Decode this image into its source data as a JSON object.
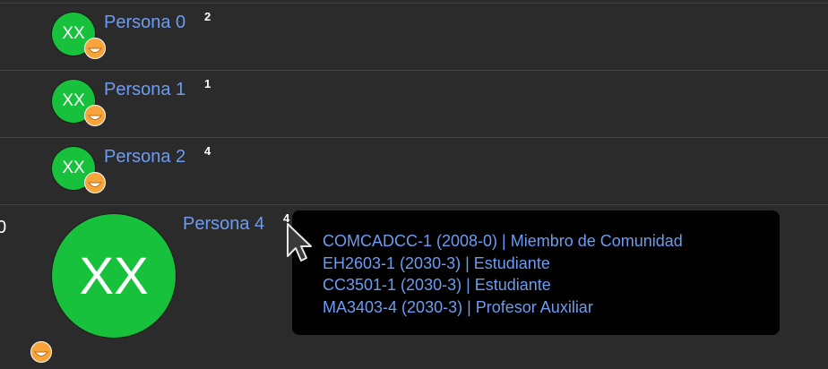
{
  "people": [
    {
      "name": "Persona 0",
      "count": "2",
      "initials": "XX"
    },
    {
      "name": "Persona 1",
      "count": "1",
      "initials": "XX"
    },
    {
      "name": "Persona 2",
      "count": "4",
      "initials": "XX"
    }
  ],
  "highlighted": {
    "name": "Persona 4",
    "count": "4",
    "initials": "XX",
    "left_digit": "0"
  },
  "tooltip": {
    "lines": [
      "COMCADCC-1 (2008-0) | Miembro de Comunidad",
      "EH2603-1 (2030-3) | Estudiante",
      "CC3501-1 (2030-3) | Estudiante",
      "MA3403-4 (2030-3) | Profesor Auxiliar"
    ]
  },
  "icons": {
    "badge": "smiley-face-icon",
    "pointer": "mouse-cursor-icon"
  },
  "colors": {
    "avatar": "#17c13c",
    "link": "#6c9cf2",
    "badge": "#f7a43a",
    "background": "#2b2b2b"
  }
}
